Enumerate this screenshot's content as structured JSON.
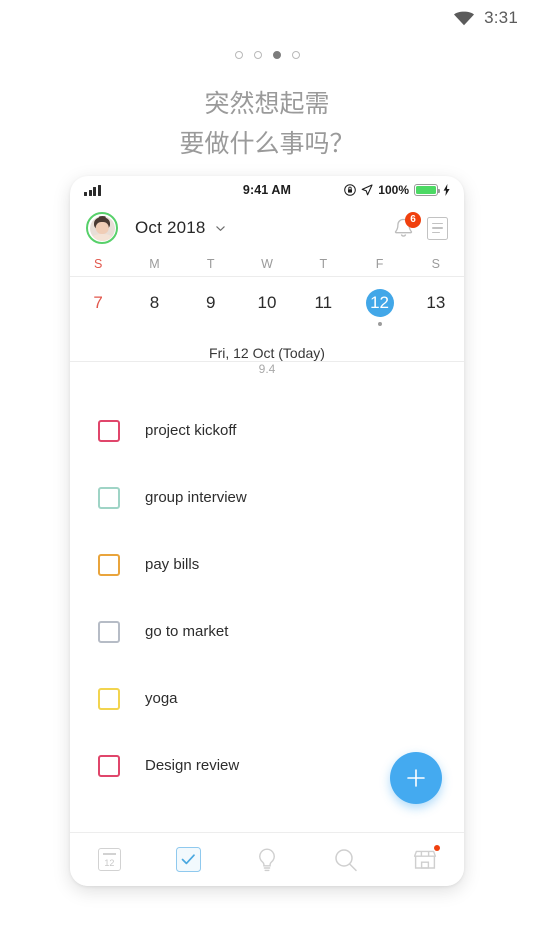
{
  "os_status": {
    "time": "3:31",
    "wifi_icon": "wifi-icon"
  },
  "carousel": {
    "total": 4,
    "active_index": 2
  },
  "headline": {
    "line1": "突然想起需",
    "line2": "要做什么事吗？"
  },
  "phone": {
    "ios_status": {
      "signal_icon": "signal-bars-icon",
      "time": "9:41 AM",
      "rotation_lock_icon": "rotation-lock-icon",
      "location_icon": "location-arrow-icon",
      "battery_percent": "100%",
      "battery_icon": "battery-icon",
      "charging_icon": "lightning-bolt-icon"
    },
    "header": {
      "avatar": "user-avatar",
      "month_label": "Oct 2018",
      "chevron_icon": "chevron-down-icon",
      "bell_icon": "bell-icon",
      "bell_badge": "6",
      "list_icon": "document-list-icon"
    },
    "calendar": {
      "weekdays": [
        {
          "label": "S",
          "is_sunday": true
        },
        {
          "label": "M",
          "is_sunday": false
        },
        {
          "label": "T",
          "is_sunday": false
        },
        {
          "label": "W",
          "is_sunday": false
        },
        {
          "label": "T",
          "is_sunday": false
        },
        {
          "label": "F",
          "is_sunday": false
        },
        {
          "label": "S",
          "is_sunday": false
        }
      ],
      "days": [
        {
          "num": "7",
          "sunday": true,
          "selected": false,
          "has_event": false
        },
        {
          "num": "8",
          "sunday": false,
          "selected": false,
          "has_event": false
        },
        {
          "num": "9",
          "sunday": false,
          "selected": false,
          "has_event": false
        },
        {
          "num": "10",
          "sunday": false,
          "selected": false,
          "has_event": false
        },
        {
          "num": "11",
          "sunday": false,
          "selected": false,
          "has_event": false
        },
        {
          "num": "12",
          "sunday": false,
          "selected": true,
          "has_event": true
        },
        {
          "num": "13",
          "sunday": false,
          "selected": false,
          "has_event": false
        }
      ],
      "selected_color": "#42a7e8",
      "sunday_color": "#e2574c"
    },
    "today_header": {
      "label": "Fri, 12 Oct (Today)",
      "sublabel": "9.4"
    },
    "tasks": [
      {
        "label": "project kickoff",
        "color": "#e0466b",
        "checked": false
      },
      {
        "label": "group interview",
        "color": "#9fd4c6",
        "checked": false
      },
      {
        "label": "pay bills",
        "color": "#e9a43c",
        "checked": false
      },
      {
        "label": "go to market",
        "color": "#b6bcc6",
        "checked": false
      },
      {
        "label": "yoga",
        "color": "#f2d44f",
        "checked": false
      },
      {
        "label": "Design review",
        "color": "#e0466b",
        "checked": false
      }
    ],
    "fab": {
      "icon": "plus-icon",
      "color": "#44aaf0"
    },
    "bottom_nav": [
      {
        "name": "tab-calendar",
        "icon": "calendar-icon",
        "label": "12",
        "active": false,
        "badge": false
      },
      {
        "name": "tab-tasks",
        "icon": "checkbox-check-icon",
        "label": "",
        "active": true,
        "badge": false
      },
      {
        "name": "tab-ideas",
        "icon": "lightbulb-icon",
        "label": "",
        "active": false,
        "badge": false
      },
      {
        "name": "tab-search",
        "icon": "search-icon",
        "label": "",
        "active": false,
        "badge": false
      },
      {
        "name": "tab-store",
        "icon": "store-icon",
        "label": "",
        "active": false,
        "badge": true
      }
    ]
  }
}
